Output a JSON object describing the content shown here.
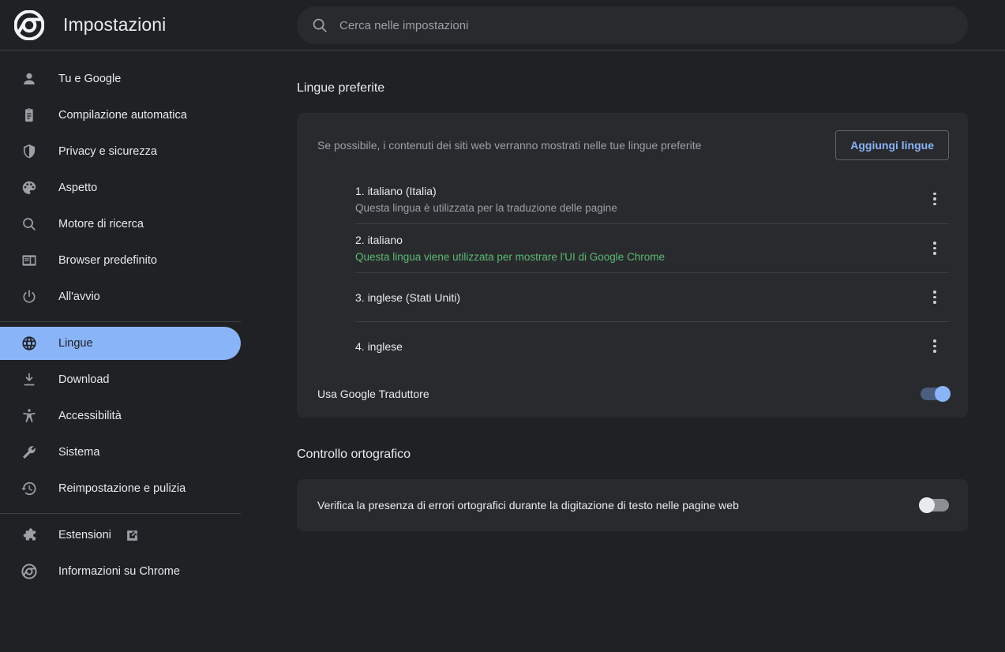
{
  "header": {
    "logo_icon": "chrome-logo-icon",
    "title": "Impostazioni",
    "search": {
      "icon": "search-icon",
      "placeholder": "Cerca nelle impostazioni",
      "value": ""
    }
  },
  "sidebar": {
    "items": [
      {
        "label": "Tu e Google",
        "icon": "person-icon",
        "selected": false
      },
      {
        "label": "Compilazione automatica",
        "icon": "clipboard-icon",
        "selected": false
      },
      {
        "label": "Privacy e sicurezza",
        "icon": "shield-icon",
        "selected": false
      },
      {
        "label": "Aspetto",
        "icon": "palette-icon",
        "selected": false
      },
      {
        "label": "Motore di ricerca",
        "icon": "search-icon",
        "selected": false
      },
      {
        "label": "Browser predefinito",
        "icon": "browser-window-icon",
        "selected": false
      },
      {
        "label": "All'avvio",
        "icon": "power-icon",
        "selected": false
      },
      {
        "label": "Lingue",
        "icon": "globe-icon",
        "selected": true
      },
      {
        "label": "Download",
        "icon": "download-icon",
        "selected": false
      },
      {
        "label": "Accessibilità",
        "icon": "accessibility-icon",
        "selected": false
      },
      {
        "label": "Sistema",
        "icon": "wrench-icon",
        "selected": false
      },
      {
        "label": "Reimpostazione e pulizia",
        "icon": "history-restore-icon",
        "selected": false
      },
      {
        "label": "Estensioni",
        "icon": "puzzle-icon",
        "selected": false,
        "external": true,
        "external_icon": "external-link-icon"
      },
      {
        "label": "Informazioni su Chrome",
        "icon": "chrome-logo-icon",
        "selected": false
      }
    ]
  },
  "main": {
    "languages_section": {
      "title": "Lingue preferite",
      "description": "Se possibile, i contenuti dei siti web verranno mostrati nelle tue lingue preferite",
      "add_button": "Aggiungi lingue",
      "rows": [
        {
          "name": "1. italiano (Italia)",
          "subtitle": "Questa lingua è utilizzata per la traduzione delle pagine",
          "subtitle_style": "muted",
          "menu_icon": "more-vert-icon"
        },
        {
          "name": "2. italiano",
          "subtitle": "Questa lingua viene utilizzata per mostrare l'UI di Google Chrome",
          "subtitle_style": "ui",
          "menu_icon": "more-vert-icon"
        },
        {
          "name": "3. inglese (Stati Uniti)",
          "subtitle": "",
          "subtitle_style": "muted",
          "menu_icon": "more-vert-icon"
        },
        {
          "name": "4. inglese",
          "subtitle": "",
          "subtitle_style": "muted",
          "menu_icon": "more-vert-icon"
        }
      ],
      "translate_toggle": {
        "label": "Usa Google Traduttore",
        "state": "on"
      }
    },
    "spellcheck_section": {
      "title": "Controllo ortografico",
      "toggle": {
        "label": "Verifica la presenza di errori ortografici durante la digitazione di testo nelle pagine web",
        "state": "off"
      }
    }
  },
  "colors": {
    "page_bg": "#202124",
    "card_bg": "#292a2d",
    "accent": "#8ab4f8",
    "text_primary": "#e8eaed",
    "text_secondary": "#9aa0a6",
    "ui_language_green": "#5bb974",
    "divider": "#3c4043"
  }
}
